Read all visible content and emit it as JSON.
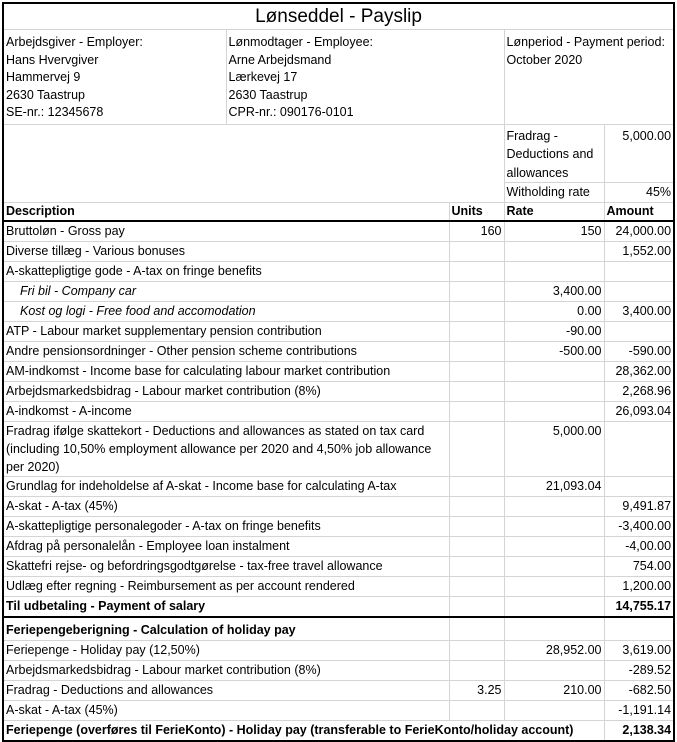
{
  "title": "Lønseddel - Payslip",
  "employer": {
    "label": "Arbejdsgiver - Employer:",
    "name": "Hans Hvervgiver",
    "street": "Hammervej 9",
    "city": "2630 Taastrup",
    "id": "SE-nr.: 12345678"
  },
  "employee": {
    "label": "Lønmodtager - Employee:",
    "name": "Arne Arbejdsmand",
    "street": "Lærkevej 17",
    "city": "2630 Taastrup",
    "id": "CPR-nr.: 090176-0101"
  },
  "period": {
    "label": "Lønperiod - Payment period:",
    "value": "October 2020"
  },
  "tax_card": {
    "deductions_label": "Fradrag - Deductions and allowances",
    "deductions_value": "5,000.00",
    "withholding_label": "Witholding rate",
    "withholding_value": "45%"
  },
  "columns": {
    "description": "Description",
    "units": "Units",
    "rate": "Rate",
    "amount": "Amount"
  },
  "rows": [
    {
      "description": "Bruttoløn - Gross pay",
      "units": "160",
      "rate": "150",
      "amount": "24,000.00"
    },
    {
      "description": "Diverse tillæg - Various bonuses",
      "units": "",
      "rate": "",
      "amount": "1,552.00"
    },
    {
      "description": "A-skattepligtige gode - A-tax on fringe benefits",
      "units": "",
      "rate": "",
      "amount": ""
    },
    {
      "description": "Fri bil - Company car",
      "units": "",
      "rate": "3,400.00",
      "amount": ""
    },
    {
      "description": "Kost og logi - Free food and accomodation",
      "units": "",
      "rate": "0.00",
      "amount": "3,400.00"
    },
    {
      "description": "ATP - Labour market supplementary pension contribution",
      "units": "",
      "rate": "-90.00",
      "amount": ""
    },
    {
      "description": "Andre pensionsordninger - Other pension scheme contributions",
      "units": "",
      "rate": "-500.00",
      "amount": "-590.00"
    },
    {
      "description": "AM-indkomst - Income base for calculating labour market contribution",
      "units": "",
      "rate": "",
      "amount": "28,362.00"
    },
    {
      "description": "Arbejdsmarkedsbidrag - Labour market contribution (8%)",
      "units": "",
      "rate": "",
      "amount": "2,268.96"
    },
    {
      "description": "A-indkomst - A-income",
      "units": "",
      "rate": "",
      "amount": "26,093.04"
    },
    {
      "description": "Fradrag ifølge skattekort - Deductions and allowances as stated on tax card (including 10,50% employment allowance per 2020 and 4,50% job allowance per 2020)",
      "units": "",
      "rate": "5,000.00",
      "amount": ""
    },
    {
      "description": "Grundlag for indeholdelse af A-skat - Income base for calculating A-tax",
      "units": "",
      "rate": "21,093.04",
      "amount": ""
    },
    {
      "description": "A-skat - A-tax (45%)",
      "units": "",
      "rate": "",
      "amount": "9,491.87"
    },
    {
      "description": "A-skattepligtige personalegoder - A-tax on fringe benefits",
      "units": "",
      "rate": "",
      "amount": "-3,400.00"
    },
    {
      "description": "Afdrag på personalelån - Employee loan instalment",
      "units": "",
      "rate": "",
      "amount": "-4,00.00"
    },
    {
      "description": "Skattefri rejse- og befordringsgodtgørelse - tax-free travel allowance",
      "units": "",
      "rate": "",
      "amount": "754.00"
    },
    {
      "description": "Udlæg efter regning - Reimbursement as per account rendered",
      "units": "",
      "rate": "",
      "amount": "1,200.00"
    }
  ],
  "salary_total": {
    "description": "Til udbetaling - Payment of salary",
    "amount": "14,755.17"
  },
  "holiday": {
    "heading": "Feriepengeberigning - Calculation of holiday pay",
    "rows": [
      {
        "description": "Feriepenge - Holiday pay (12,50%)",
        "units": "",
        "rate": "28,952.00",
        "amount": "3,619.00"
      },
      {
        "description": "Arbejdsmarkedsbidrag - Labour market contribution (8%)",
        "units": "",
        "rate": "",
        "amount": "-289.52"
      },
      {
        "description": "Fradrag - Deductions and allowances",
        "units": "3.25",
        "rate": "210.00",
        "amount": "-682.50"
      },
      {
        "description": "A-skat - A-tax (45%)",
        "units": "",
        "rate": "",
        "amount": "-1,191.14"
      }
    ],
    "total": {
      "description": "Feriepenge (overføres til FerieKonto) - Holiday pay (transferable to FerieKonto/holiday account)",
      "amount": "2,138.34"
    }
  }
}
